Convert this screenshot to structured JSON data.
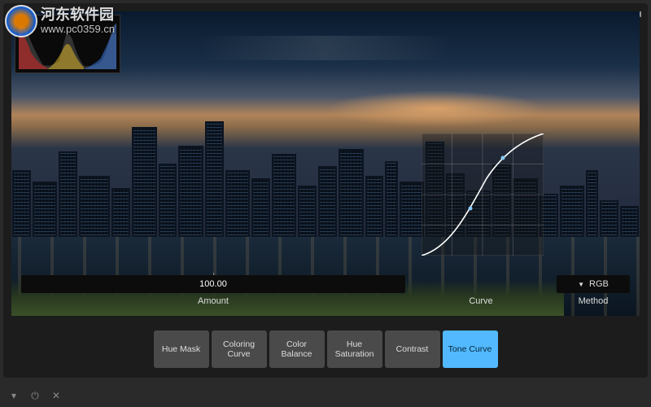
{
  "watermark": {
    "cn": "河东软件园",
    "url": "www.pc0359.cn"
  },
  "controls": {
    "amount": {
      "value": "100.00",
      "label": "Amount"
    },
    "curve": {
      "label": "Curve"
    },
    "method": {
      "value": "RGB",
      "label": "Method"
    }
  },
  "tabs": [
    {
      "label": "Hue Mask",
      "active": false
    },
    {
      "label": "Coloring Curve",
      "active": false
    },
    {
      "label": "Color Balance",
      "active": false
    },
    {
      "label": "Hue Saturation",
      "active": false
    },
    {
      "label": "Contrast",
      "active": false
    },
    {
      "label": "Tone Curve",
      "active": true
    }
  ],
  "colors": {
    "accent": "#52b9ff",
    "panel": "#4a4a4a",
    "bg": "#2a2a2a"
  }
}
